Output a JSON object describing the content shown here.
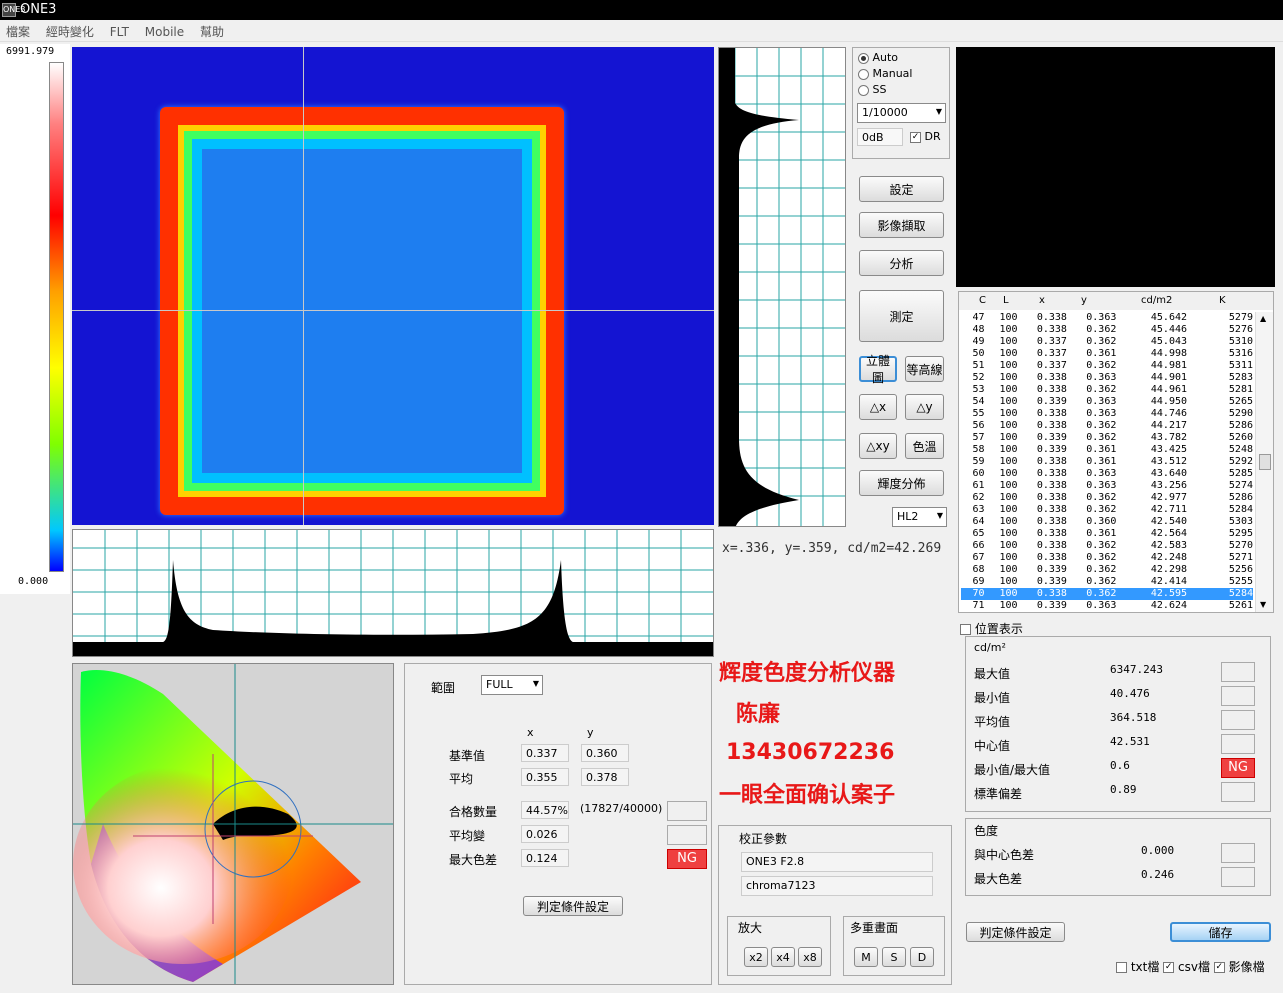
{
  "window": {
    "title": "ONE3",
    "logo": "ONE3"
  },
  "menu": [
    "檔案",
    "經時變化",
    "FLT",
    "Mobile",
    "幫助"
  ],
  "scale": {
    "max": "6991.979",
    "min": "0.000"
  },
  "exposure": {
    "modes": [
      "Auto",
      "Manual",
      "SS"
    ],
    "selected": "Auto",
    "shutter": "1/10000",
    "gain": "0dB",
    "dr_label": "DR",
    "dr_checked": true
  },
  "buttons": {
    "settings": "設定",
    "capture": "影像擷取",
    "analyze": "分析",
    "measure": "測定",
    "view3d": "立體圖",
    "contour": "等高線",
    "dx": "△x",
    "dy": "△y",
    "dxy": "△xy",
    "color_temp": "色溫",
    "lum_dist": "輝度分佈",
    "save": "儲存",
    "criteria_left": "判定條件設定",
    "criteria_right": "判定條件設定"
  },
  "hl_select": "HL2",
  "readout": "x=.336, y=.359, cd/m2=42.269",
  "table": {
    "headers": [
      "C",
      "L",
      "x",
      "y",
      "cd/m2",
      "K"
    ],
    "rows": [
      [
        "47",
        "100",
        "0.338",
        "0.363",
        "45.642",
        "5279"
      ],
      [
        "48",
        "100",
        "0.338",
        "0.362",
        "45.446",
        "5276"
      ],
      [
        "49",
        "100",
        "0.337",
        "0.362",
        "45.043",
        "5310"
      ],
      [
        "50",
        "100",
        "0.337",
        "0.361",
        "44.998",
        "5316"
      ],
      [
        "51",
        "100",
        "0.337",
        "0.362",
        "44.981",
        "5311"
      ],
      [
        "52",
        "100",
        "0.338",
        "0.363",
        "44.901",
        "5283"
      ],
      [
        "53",
        "100",
        "0.338",
        "0.362",
        "44.961",
        "5281"
      ],
      [
        "54",
        "100",
        "0.339",
        "0.363",
        "44.950",
        "5265"
      ],
      [
        "55",
        "100",
        "0.338",
        "0.363",
        "44.746",
        "5290"
      ],
      [
        "56",
        "100",
        "0.338",
        "0.362",
        "44.217",
        "5286"
      ],
      [
        "57",
        "100",
        "0.339",
        "0.362",
        "43.782",
        "5260"
      ],
      [
        "58",
        "100",
        "0.339",
        "0.361",
        "43.425",
        "5248"
      ],
      [
        "59",
        "100",
        "0.338",
        "0.361",
        "43.512",
        "5292"
      ],
      [
        "60",
        "100",
        "0.338",
        "0.363",
        "43.640",
        "5285"
      ],
      [
        "61",
        "100",
        "0.338",
        "0.363",
        "43.256",
        "5274"
      ],
      [
        "62",
        "100",
        "0.338",
        "0.362",
        "42.977",
        "5286"
      ],
      [
        "63",
        "100",
        "0.338",
        "0.362",
        "42.711",
        "5284"
      ],
      [
        "64",
        "100",
        "0.338",
        "0.360",
        "42.540",
        "5303"
      ],
      [
        "65",
        "100",
        "0.338",
        "0.361",
        "42.564",
        "5295"
      ],
      [
        "66",
        "100",
        "0.338",
        "0.362",
        "42.583",
        "5270"
      ],
      [
        "67",
        "100",
        "0.338",
        "0.362",
        "42.248",
        "5271"
      ],
      [
        "68",
        "100",
        "0.339",
        "0.362",
        "42.298",
        "5256"
      ],
      [
        "69",
        "100",
        "0.339",
        "0.362",
        "42.414",
        "5255"
      ],
      [
        "70",
        "100",
        "0.338",
        "0.362",
        "42.595",
        "5284"
      ],
      [
        "71",
        "100",
        "0.339",
        "0.363",
        "42.624",
        "5261"
      ]
    ],
    "highlighted_row": "70"
  },
  "position_display": "位置表示",
  "stats": {
    "unit": "cd/m²",
    "rows": [
      {
        "label": "最大值",
        "value": "6347.243",
        "ng": false
      },
      {
        "label": "最小值",
        "value": "40.476",
        "ng": false
      },
      {
        "label": "平均值",
        "value": "364.518",
        "ng": false
      },
      {
        "label": "中心值",
        "value": "42.531",
        "ng": false
      },
      {
        "label": "最小值/最大值",
        "value": "0.6",
        "ng": true
      },
      {
        "label": "標準偏差",
        "value": "0.89",
        "ng": false
      }
    ],
    "ng_text": "NG"
  },
  "chroma": {
    "title": "色度",
    "rows": [
      {
        "label": "與中心色差",
        "value": "0.000"
      },
      {
        "label": "最大色差",
        "value": "0.246"
      }
    ]
  },
  "file_opts": [
    {
      "label": "txt檔",
      "checked": false
    },
    {
      "label": "csv檔",
      "checked": true
    },
    {
      "label": "影像檔",
      "checked": true
    }
  ],
  "judge": {
    "range_label": "範圍",
    "range_value": "FULL",
    "col_x": "x",
    "col_y": "y",
    "ref_label": "基準值",
    "ref_x": "0.337",
    "ref_y": "0.360",
    "avg_label": "平均",
    "avg_x": "0.355",
    "avg_y": "0.378",
    "pass_label": "合格數量",
    "pass_pct": "44.57%",
    "pass_count": "(17827/40000)",
    "avg_change_label": "平均變",
    "avg_change": "0.026",
    "max_diff_label": "最大色差",
    "max_diff": "0.124",
    "ng_text": "NG"
  },
  "calib": {
    "title": "校正參數",
    "lens": "ONE3 F2.8",
    "profile": "chroma7123"
  },
  "zoom": {
    "title": "放大",
    "buttons": [
      "x2",
      "x4",
      "x8"
    ]
  },
  "multi": {
    "title": "多重畫面",
    "buttons": [
      "M",
      "S",
      "D"
    ]
  },
  "watermark": {
    "line1": "辉度色度分析仪器",
    "line2": "陈廉",
    "line3": "13430672236",
    "line4": "一眼全面确认案子"
  },
  "colors": {
    "ng": "#ef4040",
    "highlight": "#3399ff",
    "heatmap_bg": "#1010d8",
    "watermark": "#e81818"
  }
}
